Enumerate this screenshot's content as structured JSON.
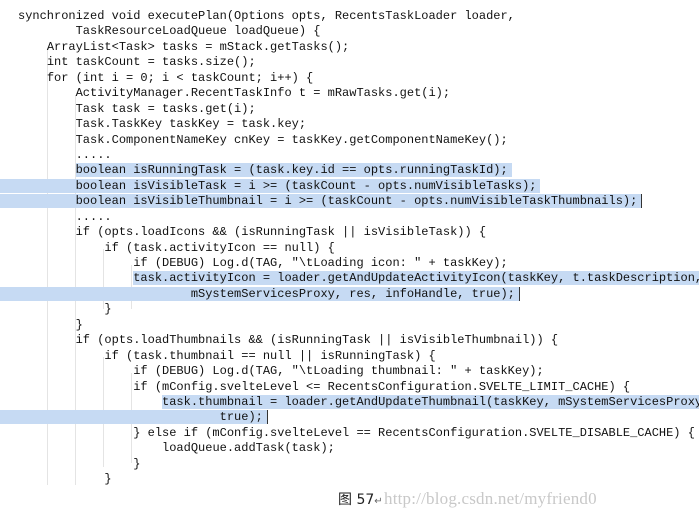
{
  "code": {
    "lines": [
      {
        "lead": "",
        "text": "synchronized void executePlan(Options opts, RecentsTaskLoader loader,",
        "sel": "none"
      },
      {
        "lead": "        ",
        "text": "TaskResourceLoadQueue loadQueue) {",
        "sel": "none"
      },
      {
        "lead": "    ",
        "text": "ArrayList<Task> tasks = mStack.getTasks();",
        "sel": "none"
      },
      {
        "lead": "    ",
        "text": "int taskCount = tasks.size();",
        "sel": "none"
      },
      {
        "lead": "    ",
        "text": "for (int i = 0; i < taskCount; i++) {",
        "sel": "none"
      },
      {
        "lead": "        ",
        "text": "ActivityManager.RecentTaskInfo t = mRawTasks.get(i);",
        "sel": "none"
      },
      {
        "lead": "        ",
        "text": "Task task = tasks.get(i);",
        "sel": "none"
      },
      {
        "lead": "        ",
        "text": "Task.TaskKey taskKey = task.key;",
        "sel": "none"
      },
      {
        "lead": "        ",
        "text": "Task.ComponentNameKey cnKey = taskKey.getComponentNameKey();",
        "sel": "none"
      },
      {
        "lead": "        ",
        "text": ".....",
        "sel": "none"
      },
      {
        "lead": "        ",
        "text": "boolean isRunningTask = (task.key.id == opts.runningTaskId);",
        "sel": "partial"
      },
      {
        "lead": "        ",
        "text": "boolean isVisibleTask = i >= (taskCount - opts.numVisibleTasks);",
        "sel": "full"
      },
      {
        "lead": "        ",
        "text": "boolean isVisibleThumbnail = i >= (taskCount - opts.numVisibleTaskThumbnails);",
        "sel": "full",
        "caret": true
      },
      {
        "lead": "        ",
        "text": ".....",
        "sel": "none"
      },
      {
        "lead": "        ",
        "text": "if (opts.loadIcons && (isRunningTask || isVisibleTask)) {",
        "sel": "none"
      },
      {
        "lead": "            ",
        "text": "if (task.activityIcon == null) {",
        "sel": "none"
      },
      {
        "lead": "                ",
        "text": "if (DEBUG) Log.d(TAG, \"\\tLoading icon: \" + taskKey);",
        "sel": "none"
      },
      {
        "lead": "                ",
        "text": "task.activityIcon = loader.getAndUpdateActivityIcon(taskKey, t.taskDescription,",
        "sel": "partial"
      },
      {
        "lead": "                        ",
        "text": "mSystemServicesProxy, res, infoHandle, true);",
        "sel": "full",
        "caret": true
      },
      {
        "lead": "            ",
        "text": "}",
        "sel": "none"
      },
      {
        "lead": "        ",
        "text": "}",
        "sel": "none"
      },
      {
        "lead": "        ",
        "text": "if (opts.loadThumbnails && (isRunningTask || isVisibleThumbnail)) {",
        "sel": "none"
      },
      {
        "lead": "            ",
        "text": "if (task.thumbnail == null || isRunningTask) {",
        "sel": "none"
      },
      {
        "lead": "                ",
        "text": "if (DEBUG) Log.d(TAG, \"\\tLoading thumbnail: \" + taskKey);",
        "sel": "none"
      },
      {
        "lead": "                ",
        "text": "if (mConfig.svelteLevel <= RecentsConfiguration.SVELTE_LIMIT_CACHE) {",
        "sel": "none"
      },
      {
        "lead": "                    ",
        "text": "task.thumbnail = loader.getAndUpdateThumbnail(taskKey, mSystemServicesProxy,",
        "sel": "partial"
      },
      {
        "lead": "                            ",
        "text": "true);",
        "sel": "full",
        "caret": true
      },
      {
        "lead": "                ",
        "text": "} else if (mConfig.svelteLevel == RecentsConfiguration.SVELTE_DISABLE_CACHE) {",
        "sel": "none"
      },
      {
        "lead": "                    ",
        "text": "loadQueue.addTask(task);",
        "sel": "none"
      },
      {
        "lead": "                ",
        "text": "}",
        "sel": "none"
      },
      {
        "lead": "            ",
        "text": "}",
        "sel": "none"
      }
    ]
  },
  "caption": {
    "label": "图 57",
    "return_mark": "↵"
  },
  "watermark": "http://blog.csdn.net/myfriend0",
  "colors": {
    "selection": "#c6daf3",
    "watermark": "#c8c8c8"
  }
}
